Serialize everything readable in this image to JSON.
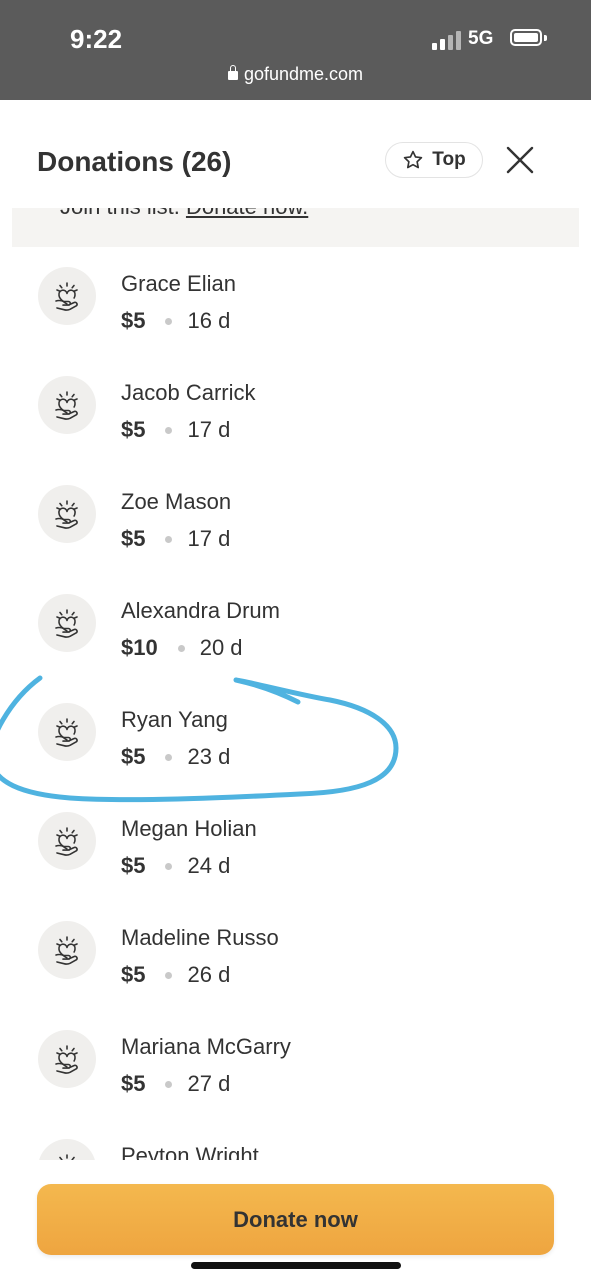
{
  "status_bar": {
    "time": "9:22",
    "network": "5G",
    "url": "gofundme.com"
  },
  "header": {
    "title": "Donations (26)",
    "top_label": "Top"
  },
  "banner": {
    "text": "Join this list.",
    "link": "Donate now."
  },
  "donations": [
    {
      "name": "Grace Elian",
      "amount": "$5",
      "time": "16 d"
    },
    {
      "name": "Jacob Carrick",
      "amount": "$5",
      "time": "17 d"
    },
    {
      "name": "Zoe Mason",
      "amount": "$5",
      "time": "17 d"
    },
    {
      "name": "Alexandra Drum",
      "amount": "$10",
      "time": "20 d"
    },
    {
      "name": "Ryan Yang",
      "amount": "$5",
      "time": "23 d"
    },
    {
      "name": "Megan Holian",
      "amount": "$5",
      "time": "24 d"
    },
    {
      "name": "Madeline Russo",
      "amount": "$5",
      "time": "26 d"
    },
    {
      "name": "Mariana McGarry",
      "amount": "$5",
      "time": "27 d"
    },
    {
      "name": "Peyton Wright",
      "amount": "",
      "time": ""
    }
  ],
  "donate_button": {
    "label": "Donate now"
  },
  "colors": {
    "status_bar_bg": "#5b5b5b",
    "button_accent": "#f0ad45",
    "highlight_stroke": "#4fb3e0",
    "avatar_bg": "#f0efed"
  },
  "icons": {
    "avatar": "heart-hand-icon",
    "sort": "star-icon",
    "close": "close-icon"
  }
}
